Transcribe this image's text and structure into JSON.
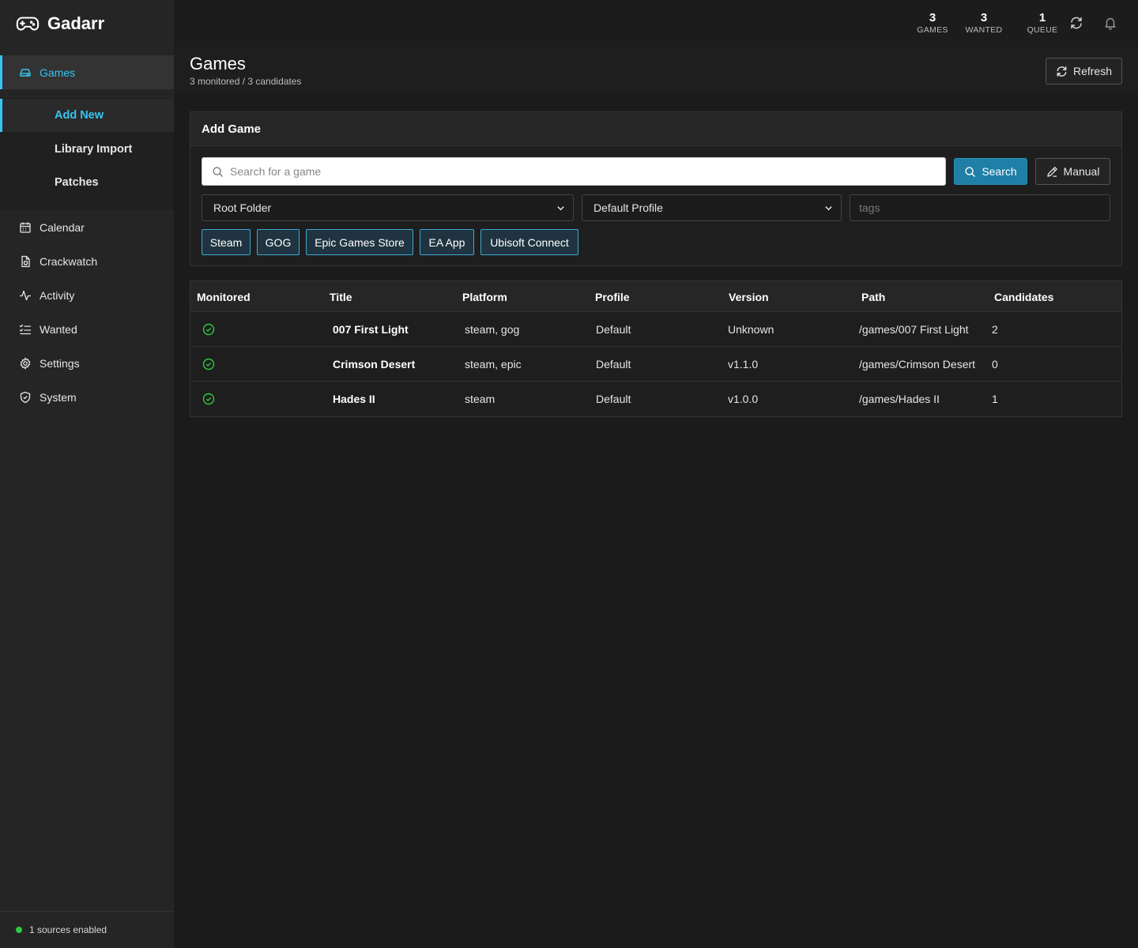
{
  "app": {
    "name": "Gadarr"
  },
  "sidebar": {
    "items": [
      {
        "label": "Games",
        "icon": "hard-drive-icon",
        "active": true
      },
      {
        "label": "Calendar",
        "icon": "calendar-icon"
      },
      {
        "label": "Crackwatch",
        "icon": "file-shield-icon"
      },
      {
        "label": "Activity",
        "icon": "activity-icon"
      },
      {
        "label": "Wanted",
        "icon": "list-check-icon"
      },
      {
        "label": "Settings",
        "icon": "gear-icon"
      },
      {
        "label": "System",
        "icon": "shield-icon"
      }
    ],
    "subitems": [
      {
        "label": "Add New",
        "active": true
      },
      {
        "label": "Library Import"
      },
      {
        "label": "Patches"
      }
    ],
    "footer": {
      "status_text": "1 sources enabled",
      "status_color": "#2ecc40"
    }
  },
  "topbar": {
    "stats": [
      {
        "value": "3",
        "label": "GAMES"
      },
      {
        "value": "3",
        "label": "WANTED"
      },
      {
        "value": "1",
        "label": "QUEUE"
      }
    ]
  },
  "page": {
    "title": "Games",
    "subtitle": "3 monitored / 3 candidates",
    "refresh_label": "Refresh"
  },
  "add_game": {
    "title": "Add Game",
    "search_placeholder": "Search for a game",
    "search_label": "Search",
    "manual_label": "Manual",
    "root_folder": "Root Folder",
    "profile": "Default Profile",
    "tags_placeholder": "tags",
    "stores": [
      "Steam",
      "GOG",
      "Epic Games Store",
      "EA App",
      "Ubisoft Connect"
    ]
  },
  "table": {
    "columns": [
      "Monitored",
      "Title",
      "Platform",
      "Profile",
      "Version",
      "Path",
      "Candidates"
    ],
    "rows": [
      {
        "monitored": true,
        "title": "007 First Light",
        "platform": "steam, gog",
        "profile": "Default",
        "version": "Unknown",
        "path": "/games/007 First Light",
        "candidates": "2"
      },
      {
        "monitored": true,
        "title": "Crimson Desert",
        "platform": "steam, epic",
        "profile": "Default",
        "version": "v1.1.0",
        "path": "/games/Crimson Desert",
        "candidates": "0"
      },
      {
        "monitored": true,
        "title": "Hades II",
        "platform": "steam",
        "profile": "Default",
        "version": "v1.0.0",
        "path": "/games/Hades II",
        "candidates": "1"
      }
    ]
  },
  "colors": {
    "accent": "#35c5f0",
    "primary_button": "#1f7fa6",
    "monitored": "#2ecc40"
  }
}
